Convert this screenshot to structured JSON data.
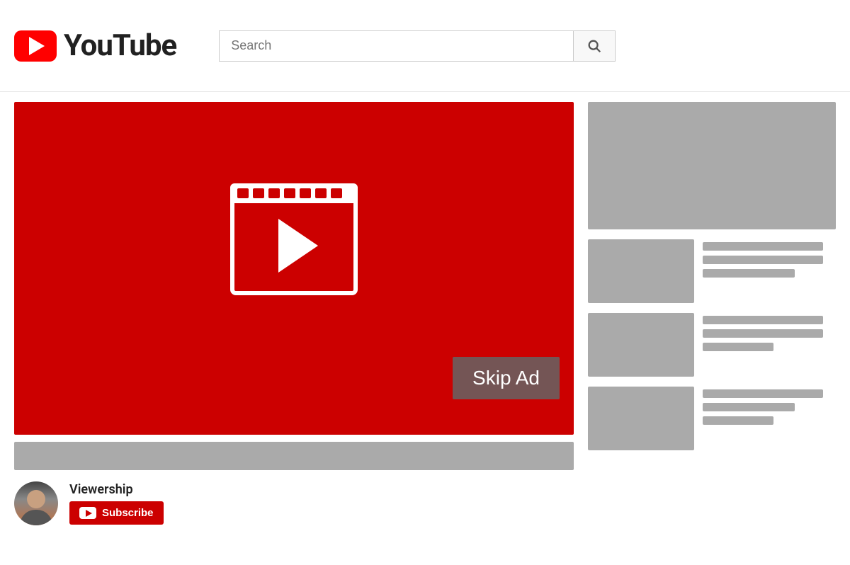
{
  "header": {
    "logo_text": "YouTube",
    "search_placeholder": "Search",
    "search_button_label": "Search"
  },
  "video": {
    "skip_ad_label": "Skip Ad",
    "is_ad": true
  },
  "channel": {
    "name": "Viewership",
    "subscribe_label": "Subscribe"
  },
  "sidebar": {
    "banner_alt": "Advertisement banner"
  },
  "related_videos": [
    {
      "id": 1
    },
    {
      "id": 2
    },
    {
      "id": 3
    }
  ],
  "icons": {
    "search": "🔍",
    "play": "▶"
  }
}
